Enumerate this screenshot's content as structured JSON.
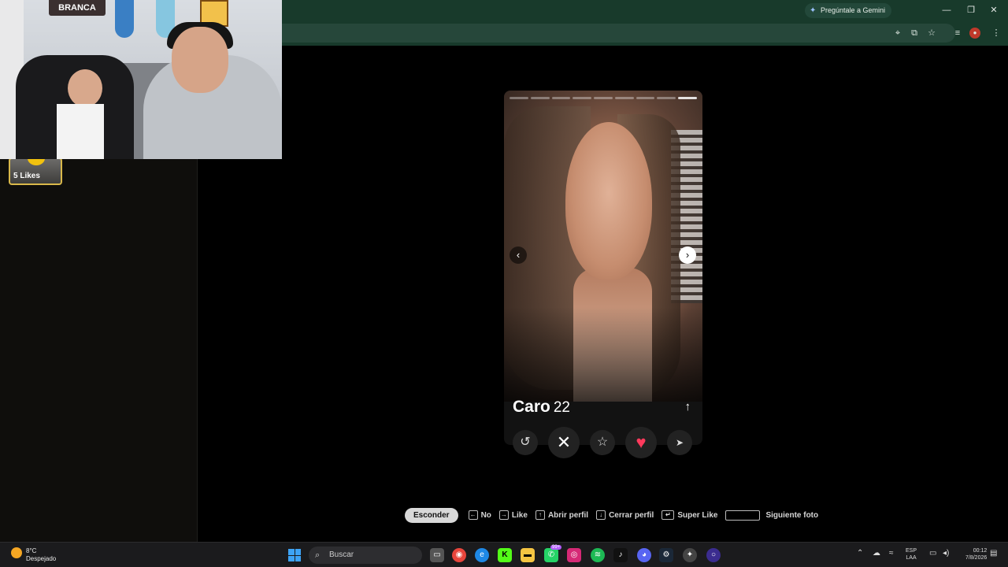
{
  "browser": {
    "gemini_label": "Pregúntale a Gemini",
    "window_controls": [
      "—",
      "❐",
      "✕"
    ],
    "toolbar_icons": [
      "location-icon",
      "install-icon",
      "bookmark-star-icon",
      "media-icon",
      "profile-icon",
      "menu-icon"
    ]
  },
  "sidebar": {
    "likes_label": "5 Likes"
  },
  "webcam": {
    "sign_text": "BRANCA"
  },
  "profile": {
    "name": "Caro",
    "age": "22",
    "photo_count": 9,
    "current_photo": 9
  },
  "actions": [
    {
      "name": "rewind-button",
      "glyph": "↺"
    },
    {
      "name": "nope-button",
      "glyph": "✕"
    },
    {
      "name": "super-like-button",
      "glyph": "☆"
    },
    {
      "name": "like-button",
      "glyph": "♥"
    },
    {
      "name": "boost-button",
      "glyph": "➤"
    }
  ],
  "hints": {
    "hide_label": "Esconder",
    "no_label": "No",
    "like_label": "Like",
    "open_profile_label": "Abrir perfil",
    "close_profile_label": "Cerrar perfil",
    "super_like_label": "Super Like",
    "next_photo_label": "Siguiente foto"
  },
  "taskbar": {
    "temperature": "8°C",
    "weather": "Despejado",
    "search_placeholder": "Buscar",
    "lang_top": "ESP",
    "lang_bottom": "LAA",
    "time": "00:12",
    "date": "7/8/2026",
    "whatsapp_badge": "99+"
  },
  "colors": {
    "chrome_bg": "#183a2b",
    "like_heart": "#ff3a5c",
    "likes_border": "#d9b84a"
  }
}
